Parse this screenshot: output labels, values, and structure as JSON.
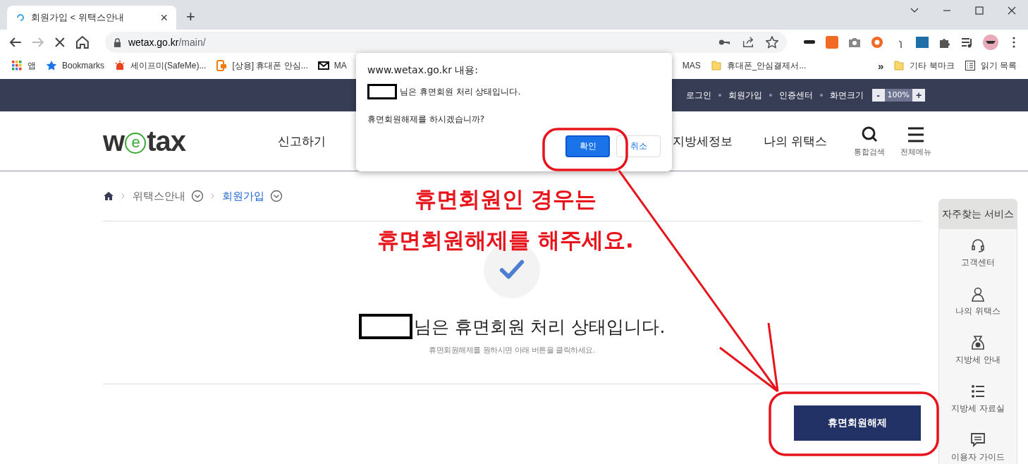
{
  "browser": {
    "tab": {
      "title": "회원가입 < 위택스안내",
      "close": "×"
    },
    "new_tab": "+",
    "url_domain": "wetax.go.kr",
    "url_path": "/main/",
    "bookmarks": [
      {
        "label": "앱",
        "kind": "apps"
      },
      {
        "label": "Bookmarks",
        "kind": "star"
      },
      {
        "label": "세이프미(SafeMe)...",
        "kind": "siren"
      },
      {
        "label": "[상용] 휴대폰 안심...",
        "kind": "phone"
      },
      {
        "label": "MA",
        "kind": "mail"
      }
    ],
    "bookmarks_after_dialog": [
      {
        "label": "MAS",
        "kind": "none"
      },
      {
        "label": "휴대폰_안심결제서...",
        "kind": "folder"
      }
    ],
    "bookmarks_overflow": "»",
    "other_bookmarks": "기타 북마크",
    "reading_list": "읽기 목록"
  },
  "top_bar": {
    "links": [
      "로그인",
      "회원가입",
      "인증센터",
      "화면크기"
    ],
    "zoom": {
      "minus": "-",
      "value": "100%",
      "plus": "+"
    }
  },
  "header": {
    "logo": [
      "w",
      "e",
      "tax"
    ],
    "nav": [
      "신고하기",
      "지방세정보",
      "나의 위택스"
    ],
    "tools": [
      {
        "label": "통합검색",
        "kind": "search"
      },
      {
        "label": "전체메뉴",
        "kind": "menu"
      }
    ]
  },
  "breadcrumb": [
    {
      "label": "위택스안내",
      "selected": false
    },
    {
      "label": "회원가입",
      "selected": true
    }
  ],
  "result": {
    "message": "님은 휴면회원 처리 상태입니다.",
    "hint": "휴면회원해제를 원하시면 아래 버튼을 클릭하세요."
  },
  "release_button": "휴면회원해제",
  "quick_menu": {
    "title": "자주찾는 서비스",
    "items": [
      {
        "label": "고객센터",
        "kind": "headset"
      },
      {
        "label": "나의 위택스",
        "kind": "person"
      },
      {
        "label": "지방세 안내",
        "kind": "bag"
      },
      {
        "label": "지방세 자료실",
        "kind": "list"
      },
      {
        "label": "이용자 가이드",
        "kind": "chat"
      }
    ]
  },
  "dialog": {
    "origin": "www.wetax.go.kr 내용:",
    "message": "님은 휴면회원 처리 상태입니다.",
    "question": "휴면회원해제를 하시겠습니까?",
    "buttons": [
      {
        "label": "확인",
        "primary": true
      },
      {
        "label": "취소",
        "primary": false
      }
    ]
  },
  "annotation": {
    "lines": [
      "휴면회원인 경우는",
      "휴면회원해제를 해주세요."
    ]
  }
}
